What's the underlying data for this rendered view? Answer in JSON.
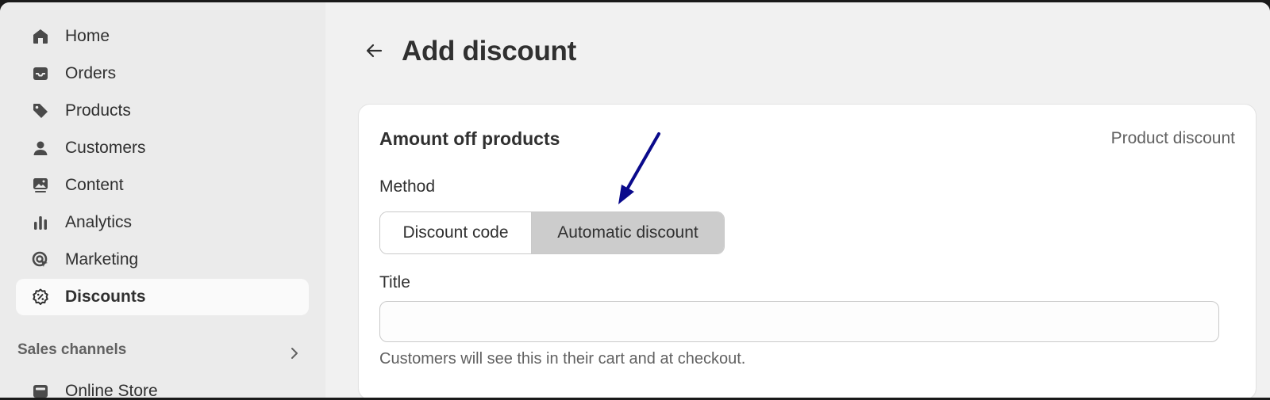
{
  "sidebar": {
    "items": [
      {
        "label": "Home",
        "icon": "home-icon"
      },
      {
        "label": "Orders",
        "icon": "inbox-icon"
      },
      {
        "label": "Products",
        "icon": "tag-icon"
      },
      {
        "label": "Customers",
        "icon": "person-icon"
      },
      {
        "label": "Content",
        "icon": "image-icon"
      },
      {
        "label": "Analytics",
        "icon": "bar-chart-icon"
      },
      {
        "label": "Marketing",
        "icon": "target-icon"
      },
      {
        "label": "Discounts",
        "icon": "discount-badge-icon",
        "active": true
      }
    ],
    "sales_channels": {
      "title": "Sales channels",
      "items": [
        {
          "label": "Online Store",
          "icon": "store-icon"
        }
      ]
    }
  },
  "page": {
    "title": "Add discount"
  },
  "card": {
    "title": "Amount off products",
    "badge": "Product discount",
    "method": {
      "label": "Method",
      "options": [
        "Discount code",
        "Automatic discount"
      ],
      "selected": "Automatic discount"
    },
    "title_field": {
      "label": "Title",
      "value": "",
      "placeholder": "",
      "help": "Customers will see this in their cart and at checkout."
    }
  },
  "colors": {
    "annotation_arrow": "#0a0a8c",
    "selected_segment": "#cccccc",
    "sidebar_bg": "#ebebeb",
    "main_bg": "#f1f1f1"
  }
}
